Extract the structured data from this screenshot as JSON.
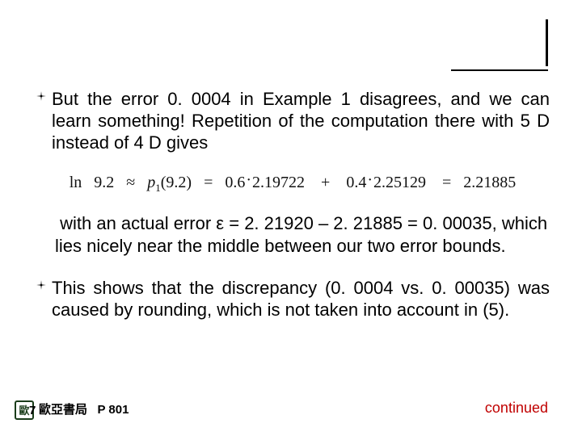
{
  "bullets": {
    "b1": "But the error 0. 0004 in Example 1 disagrees, and we can learn something! Repetition of the computation there with 5 D instead of 4 D gives",
    "b2_cont": " with an actual error ε = 2. 21920 – 2. 21885 = 0. 00035, which lies nicely near the middle between our two error bounds.",
    "b3": "This shows that the discrepancy (0. 0004 vs. 0. 00035) was caused by rounding, which is not taken into account in (5)."
  },
  "equation": {
    "lhs_fn": "ln",
    "lhs_arg": "9.2",
    "approx": "≈",
    "p_sym": "p",
    "p_sub": "1",
    "p_arg": "(9.2)",
    "eq": "=",
    "t1a": "0.6",
    "t1b": "2.19722",
    "plus": "+",
    "t2a": "0.4",
    "t2b": "2.25129",
    "rhs": "2.21885",
    "dot": "·"
  },
  "footer": {
    "logo_char": "歐",
    "seven": "7",
    "publisher_prefix": "歐亞書局",
    "page_label": "P 801",
    "continued": "continued"
  }
}
